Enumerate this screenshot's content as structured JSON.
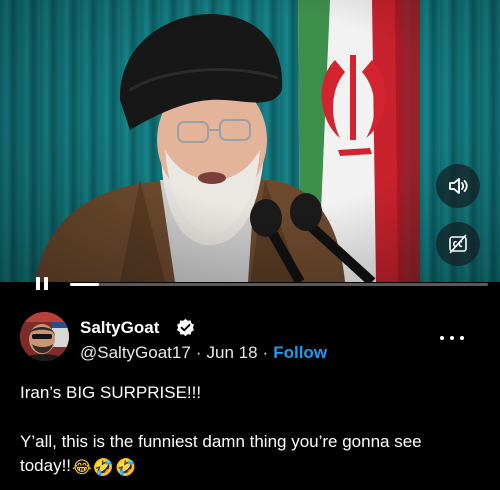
{
  "video": {
    "controls": {
      "volume_icon": "speaker-on-icon",
      "captions_icon": "closed-captions-icon",
      "pause_icon": "pause-icon"
    },
    "progress": 0.07,
    "accent": "#ffffff"
  },
  "post": {
    "author": {
      "display_name": "SaltyGoat",
      "handle": "@SaltyGoat17",
      "verified": true
    },
    "date": "Jun 18",
    "separator": "·",
    "follow_label": "Follow",
    "more_icon": "more-horizontal-icon",
    "text_line1": "Iran’s BIG SURPRISE!!!",
    "text_line2": "Y’all, this is the funniest damn thing you’re gonna see",
    "text_line3": "today!!",
    "emojis": [
      "😂",
      "🤣",
      "🤣"
    ],
    "colors": {
      "link": "#1d9bf0",
      "text": "#ffffff",
      "background": "#000000"
    }
  }
}
